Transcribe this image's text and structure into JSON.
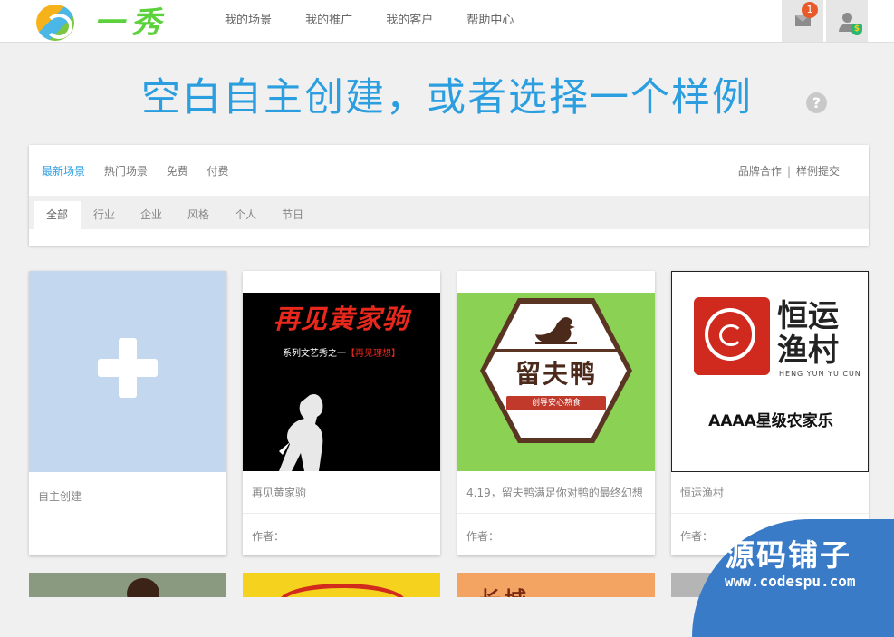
{
  "header": {
    "brand": "一秀",
    "nav": [
      "我的场景",
      "我的推广",
      "我的客户",
      "帮助中心"
    ],
    "mail_badge": "1",
    "coin_symbol": "$"
  },
  "page_title": "空白自主创建，或者选择一个样例",
  "help_icon": "?",
  "filters": {
    "tabs": [
      "最新场景",
      "热门场景",
      "免费",
      "付费"
    ],
    "links": [
      "品牌合作",
      "样例提交"
    ],
    "link_separator": "|",
    "subtabs": [
      "全部",
      "行业",
      "企业",
      "风格",
      "个人",
      "节日"
    ]
  },
  "cards": [
    {
      "name": "自主创建"
    },
    {
      "name": "再见黄家驹",
      "author": "作者："
    },
    {
      "name": "4.19，留夫鸭满足你对鸭的最终幻想",
      "author": "作者："
    },
    {
      "name": "恒运渔村",
      "author": "作者："
    }
  ],
  "thumbs": {
    "t1_title": "再见黄家驹",
    "t1_sub_pre": "系列文艺秀之一",
    "t1_sub_hl": "【再见理想】",
    "t2_brand": "留夫鸭",
    "t2_ribbon": "创导安心熟食",
    "t3_name": "恒运渔村",
    "t3_pinyin": "HENG YUN YU CUN",
    "t3_rating": "AAAA星级农家乐",
    "p2_text": "长城"
  },
  "watermark": {
    "cn": "源码铺子",
    "url": "www.codespu.com"
  },
  "colors": {
    "accent": "#2b9ee0",
    "badge": "#e85a2a",
    "create_bg": "#c3d7ee"
  }
}
